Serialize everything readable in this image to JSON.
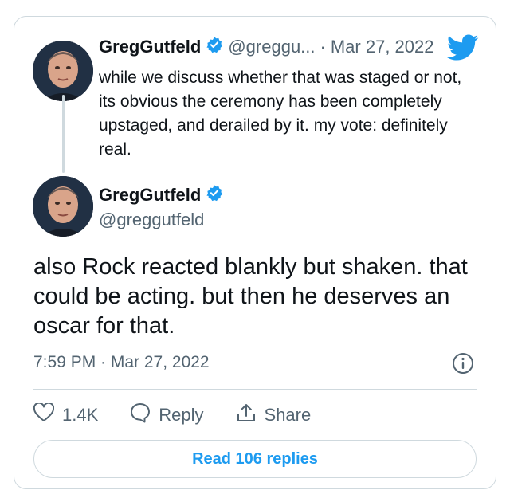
{
  "quoted_tweet": {
    "display_name": "GregGutfeld",
    "handle_truncated": "@greggu...",
    "separator": "·",
    "date": "Mar 27, 2022",
    "text": "while we discuss whether that was staged or not, its obvious the ceremony has been completely upstaged, and derailed by it.  my vote: definitely real."
  },
  "main_tweet": {
    "display_name": "GregGutfeld",
    "handle": "@greggutfeld",
    "text": "also Rock reacted blankly but shaken. that could be acting.  but then he deserves an oscar for that.",
    "timestamp": "7:59 PM · Mar 27, 2022"
  },
  "actions": {
    "likes": "1.4K",
    "reply_label": "Reply",
    "share_label": "Share"
  },
  "read_replies_label": "Read 106 replies",
  "icons": {
    "verified": "verified-badge-icon",
    "brand": "twitter-bird-icon",
    "like": "heart-icon",
    "reply": "speech-bubble-icon",
    "share": "share-arrow-icon",
    "info": "info-icon"
  },
  "colors": {
    "accent": "#1d9bf0",
    "text": "#0f1419",
    "secondary": "#536471",
    "border": "#cfd9de"
  }
}
